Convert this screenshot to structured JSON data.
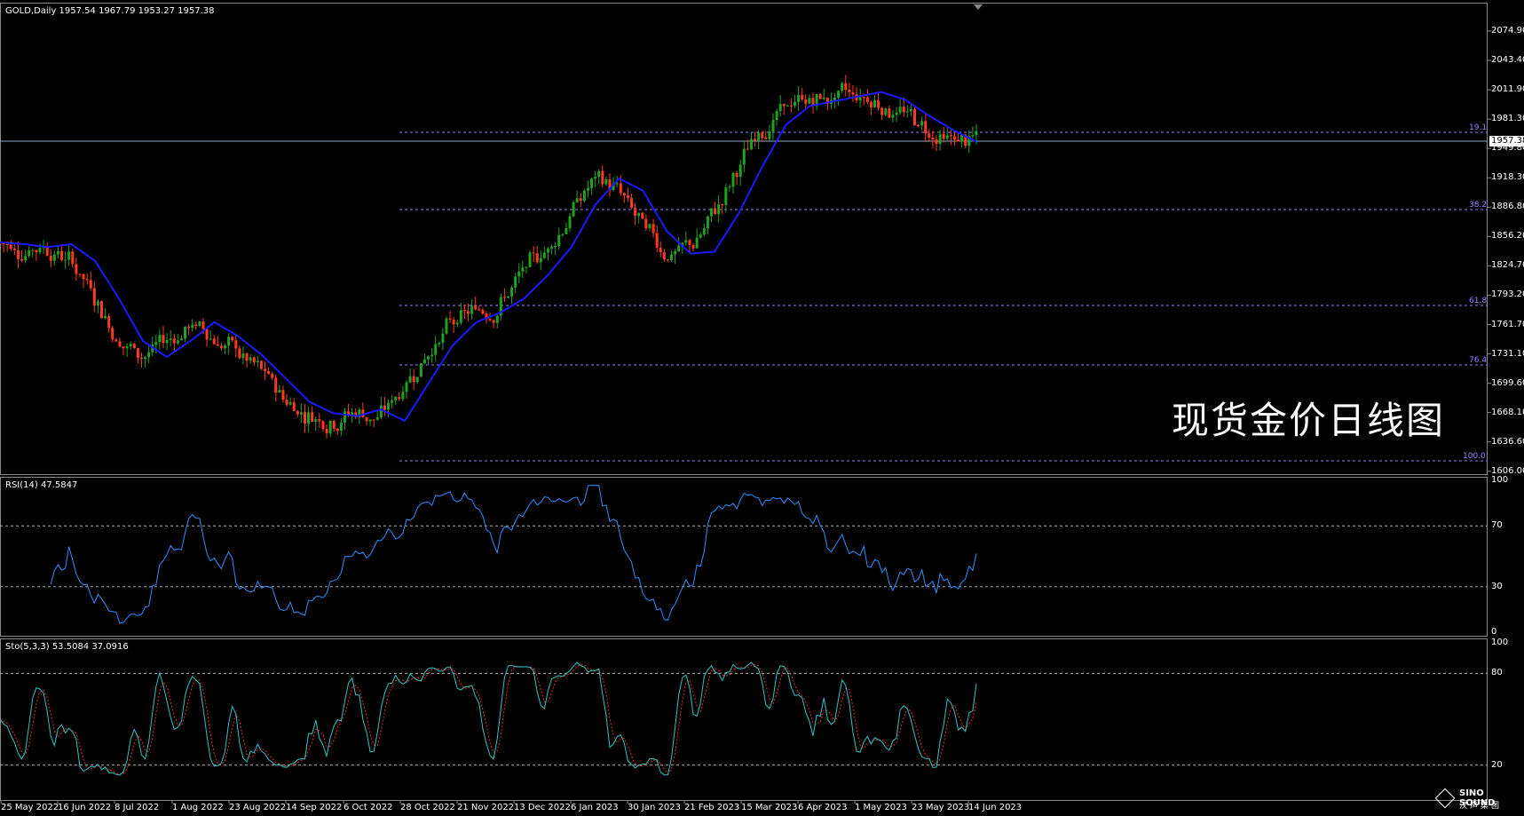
{
  "symbol_header": "GOLD,Daily  1957.54 1967.79 1953.27 1957.38",
  "chart_title": "现货金价日线图",
  "current_price": "1957.38",
  "price_axis": [
    "2074.90",
    "2043.40",
    "2011.90",
    "1981.30",
    "1949.80",
    "1918.30",
    "1886.80",
    "1856.20",
    "1824.70",
    "1793.20",
    "1761.70",
    "1731.10",
    "1699.60",
    "1668.10",
    "1636.60",
    "1606.00"
  ],
  "fib_levels": [
    "19.1",
    "38.2",
    "61.8",
    "76.4",
    "100.0"
  ],
  "rsi_label": "RSI(14) 47.5847",
  "rsi_axis": [
    "100",
    "70",
    "30",
    "0"
  ],
  "sto_label": "Sto(5,3,3) 53.5084 37.0916",
  "sto_axis": [
    "100",
    "80",
    "20"
  ],
  "date_axis": [
    "25 May 2022",
    "16 Jun 2022",
    "8 Jul 2022",
    "1 Aug 2022",
    "23 Aug 2022",
    "14 Sep 2022",
    "6 Oct 2022",
    "28 Oct 2022",
    "21 Nov 2022",
    "13 Dec 2022",
    "6 Jan 2023",
    "30 Jan 2023",
    "21 Feb 2023",
    "15 Mar 2023",
    "6 Apr 2023",
    "1 May 2023",
    "23 May 2023",
    "14 Jun 2023"
  ],
  "logo": {
    "name": "SINO SOUND",
    "sub": "汉声集团"
  },
  "colors": {
    "bull": "#1fa31f",
    "bear": "#ff3a1f",
    "ma": "#1a1aff",
    "rsi": "#2f8fff",
    "sto_main": "#2ec4c4",
    "sto_signal": "#e03030",
    "fib": "#9b7cff"
  },
  "chart_data": {
    "type": "line",
    "price_ma_approx": [
      1850,
      1848,
      1845,
      1848,
      1830,
      1790,
      1745,
      1728,
      1745,
      1765,
      1750,
      1730,
      1705,
      1680,
      1668,
      1665,
      1672,
      1660,
      1700,
      1740,
      1765,
      1775,
      1790,
      1815,
      1845,
      1890,
      1918,
      1905,
      1862,
      1838,
      1840,
      1880,
      1930,
      1975,
      1995,
      2000,
      2005,
      2010,
      2002,
      1985,
      1970,
      1957
    ],
    "ohlc_last": {
      "open": 1957.54,
      "high": 1967.79,
      "low": 1953.27,
      "close": 1957.38
    },
    "rsi_last": 47.5847,
    "sto_last": {
      "main": 53.5084,
      "signal": 37.0916
    }
  }
}
